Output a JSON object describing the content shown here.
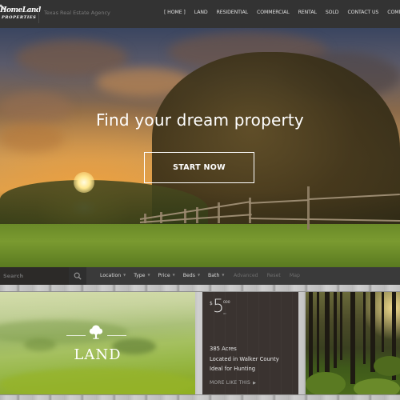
{
  "header": {
    "logo": {
      "line1": "HomeLand",
      "line2": "PROPERTIES"
    },
    "tagline": "Texas Real Estate Agency",
    "nav": [
      {
        "label": "[ HOME ]",
        "active": true
      },
      {
        "label": "LAND"
      },
      {
        "label": "RESIDENTIAL"
      },
      {
        "label": "COMMERCIAL"
      },
      {
        "label": "RENTAL"
      },
      {
        "label": "SOLD"
      },
      {
        "label": "CONTACT US"
      },
      {
        "label": "COMMUNITY"
      }
    ]
  },
  "hero": {
    "title": "Find your dream property",
    "cta_label": "START NOW"
  },
  "search": {
    "placeholder": "Search",
    "icon": "search-icon",
    "filters": [
      {
        "label": "Location"
      },
      {
        "label": "Type"
      },
      {
        "label": "Price"
      },
      {
        "label": "Beds"
      },
      {
        "label": "Bath"
      }
    ],
    "links": [
      {
        "label": "Advanced"
      },
      {
        "label": "Reset"
      },
      {
        "label": "Map"
      }
    ]
  },
  "cards": {
    "land": {
      "title": "LAND",
      "icon": "tree-icon"
    },
    "listing": {
      "currency": "$",
      "price_main": "5",
      "price_sup": "000",
      "price_unit": "ac",
      "details": [
        "385 Acres",
        "Located in Walker County",
        "Ideal for Hunting"
      ],
      "more_label": "MORE LIKE THIS",
      "more_icon": "caret-right-icon"
    },
    "forest": {
      "alt": "forest photo"
    }
  },
  "colors": {
    "header_bg": "#333333",
    "searchbar_bg": "#3a3a3a",
    "listing_bg": "#3a3330"
  }
}
